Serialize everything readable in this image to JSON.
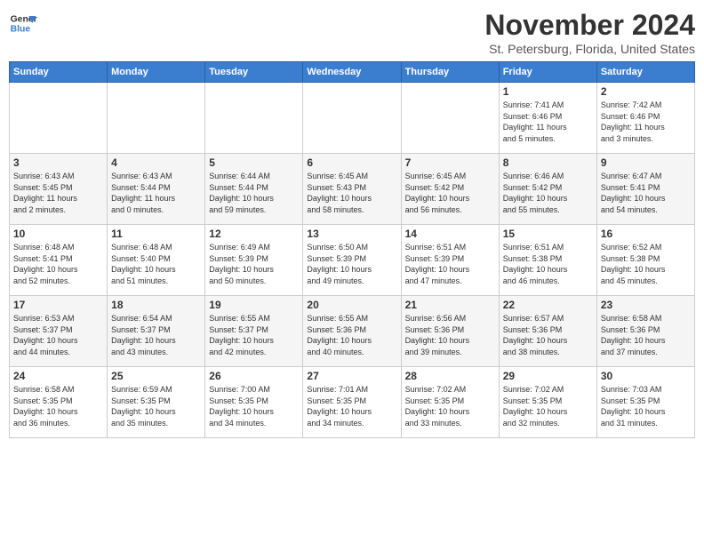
{
  "header": {
    "logo_line1": "General",
    "logo_line2": "Blue",
    "month_title": "November 2024",
    "location": "St. Petersburg, Florida, United States"
  },
  "days_of_week": [
    "Sunday",
    "Monday",
    "Tuesday",
    "Wednesday",
    "Thursday",
    "Friday",
    "Saturday"
  ],
  "weeks": [
    [
      {
        "day": "",
        "info": ""
      },
      {
        "day": "",
        "info": ""
      },
      {
        "day": "",
        "info": ""
      },
      {
        "day": "",
        "info": ""
      },
      {
        "day": "",
        "info": ""
      },
      {
        "day": "1",
        "info": "Sunrise: 7:41 AM\nSunset: 6:46 PM\nDaylight: 11 hours\nand 5 minutes."
      },
      {
        "day": "2",
        "info": "Sunrise: 7:42 AM\nSunset: 6:46 PM\nDaylight: 11 hours\nand 3 minutes."
      }
    ],
    [
      {
        "day": "3",
        "info": "Sunrise: 6:43 AM\nSunset: 5:45 PM\nDaylight: 11 hours\nand 2 minutes."
      },
      {
        "day": "4",
        "info": "Sunrise: 6:43 AM\nSunset: 5:44 PM\nDaylight: 11 hours\nand 0 minutes."
      },
      {
        "day": "5",
        "info": "Sunrise: 6:44 AM\nSunset: 5:44 PM\nDaylight: 10 hours\nand 59 minutes."
      },
      {
        "day": "6",
        "info": "Sunrise: 6:45 AM\nSunset: 5:43 PM\nDaylight: 10 hours\nand 58 minutes."
      },
      {
        "day": "7",
        "info": "Sunrise: 6:45 AM\nSunset: 5:42 PM\nDaylight: 10 hours\nand 56 minutes."
      },
      {
        "day": "8",
        "info": "Sunrise: 6:46 AM\nSunset: 5:42 PM\nDaylight: 10 hours\nand 55 minutes."
      },
      {
        "day": "9",
        "info": "Sunrise: 6:47 AM\nSunset: 5:41 PM\nDaylight: 10 hours\nand 54 minutes."
      }
    ],
    [
      {
        "day": "10",
        "info": "Sunrise: 6:48 AM\nSunset: 5:41 PM\nDaylight: 10 hours\nand 52 minutes."
      },
      {
        "day": "11",
        "info": "Sunrise: 6:48 AM\nSunset: 5:40 PM\nDaylight: 10 hours\nand 51 minutes."
      },
      {
        "day": "12",
        "info": "Sunrise: 6:49 AM\nSunset: 5:39 PM\nDaylight: 10 hours\nand 50 minutes."
      },
      {
        "day": "13",
        "info": "Sunrise: 6:50 AM\nSunset: 5:39 PM\nDaylight: 10 hours\nand 49 minutes."
      },
      {
        "day": "14",
        "info": "Sunrise: 6:51 AM\nSunset: 5:39 PM\nDaylight: 10 hours\nand 47 minutes."
      },
      {
        "day": "15",
        "info": "Sunrise: 6:51 AM\nSunset: 5:38 PM\nDaylight: 10 hours\nand 46 minutes."
      },
      {
        "day": "16",
        "info": "Sunrise: 6:52 AM\nSunset: 5:38 PM\nDaylight: 10 hours\nand 45 minutes."
      }
    ],
    [
      {
        "day": "17",
        "info": "Sunrise: 6:53 AM\nSunset: 5:37 PM\nDaylight: 10 hours\nand 44 minutes."
      },
      {
        "day": "18",
        "info": "Sunrise: 6:54 AM\nSunset: 5:37 PM\nDaylight: 10 hours\nand 43 minutes."
      },
      {
        "day": "19",
        "info": "Sunrise: 6:55 AM\nSunset: 5:37 PM\nDaylight: 10 hours\nand 42 minutes."
      },
      {
        "day": "20",
        "info": "Sunrise: 6:55 AM\nSunset: 5:36 PM\nDaylight: 10 hours\nand 40 minutes."
      },
      {
        "day": "21",
        "info": "Sunrise: 6:56 AM\nSunset: 5:36 PM\nDaylight: 10 hours\nand 39 minutes."
      },
      {
        "day": "22",
        "info": "Sunrise: 6:57 AM\nSunset: 5:36 PM\nDaylight: 10 hours\nand 38 minutes."
      },
      {
        "day": "23",
        "info": "Sunrise: 6:58 AM\nSunset: 5:36 PM\nDaylight: 10 hours\nand 37 minutes."
      }
    ],
    [
      {
        "day": "24",
        "info": "Sunrise: 6:58 AM\nSunset: 5:35 PM\nDaylight: 10 hours\nand 36 minutes."
      },
      {
        "day": "25",
        "info": "Sunrise: 6:59 AM\nSunset: 5:35 PM\nDaylight: 10 hours\nand 35 minutes."
      },
      {
        "day": "26",
        "info": "Sunrise: 7:00 AM\nSunset: 5:35 PM\nDaylight: 10 hours\nand 34 minutes."
      },
      {
        "day": "27",
        "info": "Sunrise: 7:01 AM\nSunset: 5:35 PM\nDaylight: 10 hours\nand 34 minutes."
      },
      {
        "day": "28",
        "info": "Sunrise: 7:02 AM\nSunset: 5:35 PM\nDaylight: 10 hours\nand 33 minutes."
      },
      {
        "day": "29",
        "info": "Sunrise: 7:02 AM\nSunset: 5:35 PM\nDaylight: 10 hours\nand 32 minutes."
      },
      {
        "day": "30",
        "info": "Sunrise: 7:03 AM\nSunset: 5:35 PM\nDaylight: 10 hours\nand 31 minutes."
      }
    ]
  ]
}
